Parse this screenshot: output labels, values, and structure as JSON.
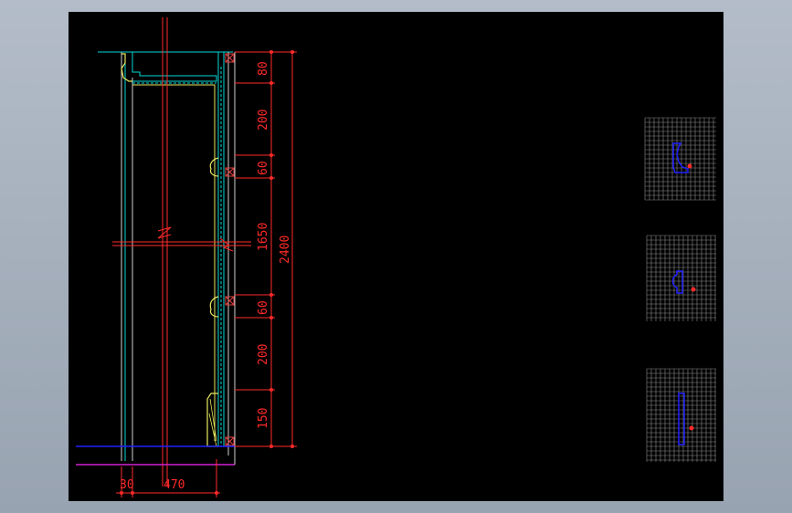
{
  "colors": {
    "background_frame": "#a6b0bd",
    "canvas": "#000000",
    "dimension": "#ff2a2a",
    "cyan": "#00d8d8",
    "yellow": "#e8e860",
    "white": "#d0d0d0",
    "blue": "#2020ff",
    "magenta": "#d020d0",
    "grid": "#8a8a8a"
  },
  "vertical_dimensions": [
    "80",
    "200",
    "60",
    "1650",
    "60",
    "200",
    "150"
  ],
  "total_dimension": "2400",
  "horizontal_dimensions": [
    "30",
    "470"
  ],
  "thumbnails": [
    {
      "name": "profile-thumbnail-1",
      "shape": "upper-moulding"
    },
    {
      "name": "profile-thumbnail-2",
      "shape": "middle-moulding"
    },
    {
      "name": "profile-thumbnail-3",
      "shape": "base-moulding"
    }
  ]
}
